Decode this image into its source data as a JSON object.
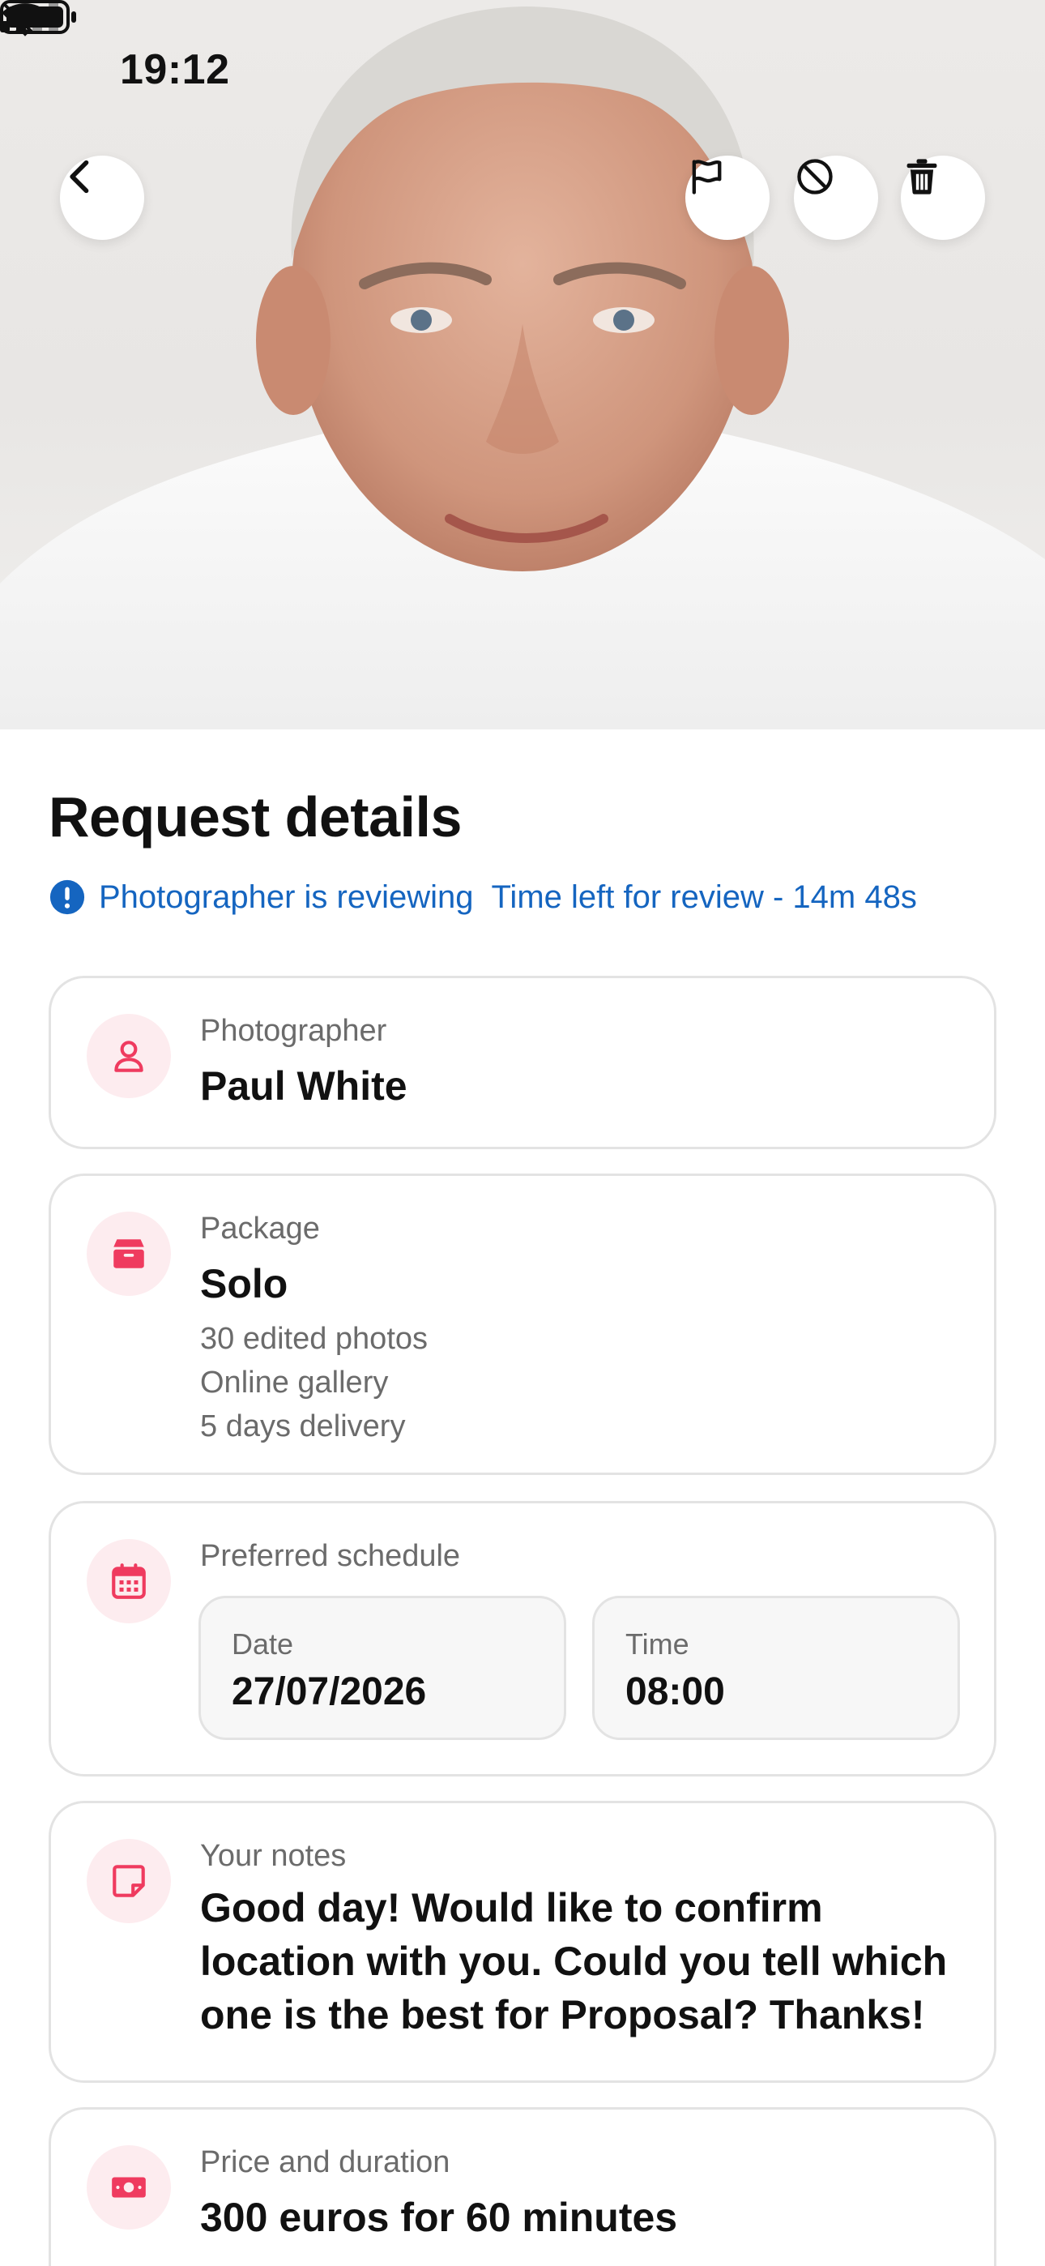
{
  "status_bar": {
    "time": "19:12",
    "icons": [
      "bell-slash-icon",
      "cellular-signal-icon",
      "wifi-icon",
      "battery-icon"
    ]
  },
  "top_actions": {
    "icons": [
      "chevron-left-icon",
      "flag-icon",
      "block-icon",
      "trash-icon"
    ]
  },
  "hero": {
    "image": "profile-photo"
  },
  "page": {
    "title": "Request details"
  },
  "review_status": {
    "icon": "exclamation-circle-icon",
    "status_text": "Photographer is reviewing",
    "time_left_text": "Time left for review - 14m 48s",
    "color": "#1565c0"
  },
  "photographer": {
    "icon": "person-icon",
    "label": "Photographer",
    "name": "Paul White"
  },
  "package": {
    "icon": "box-icon",
    "label": "Package",
    "name": "Solo",
    "features": [
      "30 edited photos",
      "Online gallery",
      "5 days delivery"
    ]
  },
  "schedule": {
    "icon": "calendar-icon",
    "label": "Preferred schedule",
    "date_label": "Date",
    "date_value": "27/07/2026",
    "time_label": "Time",
    "time_value": "08:00"
  },
  "notes": {
    "icon": "note-icon",
    "label": "Your notes",
    "text": "Good day! Would like to confirm location with you. Could you tell which one is the best for Proposal? Thanks!"
  },
  "price": {
    "icon": "banknote-icon",
    "label": "Price and duration",
    "value": "300 euros for 60 minutes"
  },
  "colors": {
    "accent": "#ef3b5f",
    "accent_bg": "#fdecef",
    "link": "#1565c0",
    "border": "#e3e3e3"
  }
}
